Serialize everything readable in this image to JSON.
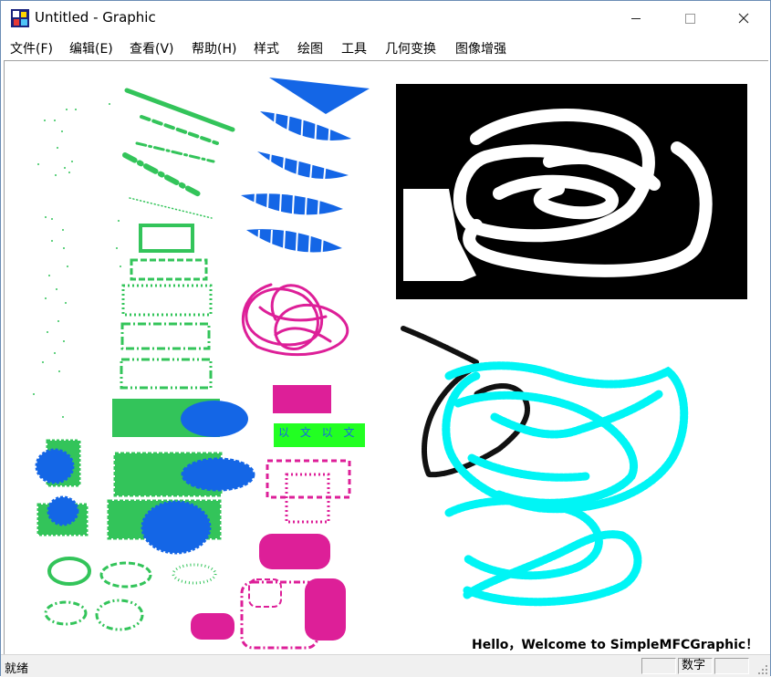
{
  "window": {
    "title": "Untitled - Graphic",
    "minimize_glyph": "—",
    "maximize_glyph": "☐",
    "close_glyph": "✕",
    "icon": "app-mfc-icon"
  },
  "menu": {
    "items": [
      {
        "label": "文件(F)"
      },
      {
        "label": "编辑(E)"
      },
      {
        "label": "查看(V)"
      },
      {
        "label": "帮助(H)"
      },
      {
        "label": "样式"
      },
      {
        "label": "绘图"
      },
      {
        "label": "工具"
      },
      {
        "label": "几何变换"
      },
      {
        "label": "图像增强"
      }
    ]
  },
  "canvas": {
    "welcome_text": "Hello，Welcome to SimpleMFCGraphic！",
    "cjk_sample_text": "以 文 以 文",
    "colors": {
      "green": "#33c45a",
      "blue": "#1466e6",
      "magenta": "#dd1f98",
      "cyan": "#00f5f5",
      "black": "#000000",
      "lime": "#22ff22"
    }
  },
  "status": {
    "ready_text": "就绪",
    "pane_numlock": "数字"
  }
}
